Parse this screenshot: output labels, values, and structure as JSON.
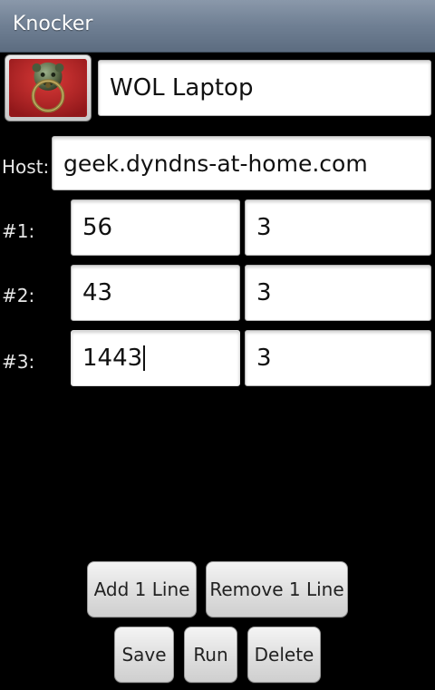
{
  "app": {
    "title": "Knocker"
  },
  "profile": {
    "name_value": "WOL Laptop"
  },
  "host": {
    "label": "Host:",
    "value": "geek.dyndns-at-home.com"
  },
  "lines": [
    {
      "label": "#1:",
      "port": "56",
      "count": "3"
    },
    {
      "label": "#2:",
      "port": "43",
      "count": "3"
    },
    {
      "label": "#3:",
      "port": "1443",
      "count": "3"
    }
  ],
  "buttons": {
    "add_line": "Add 1 Line",
    "remove_line": "Remove 1 Line",
    "save": "Save",
    "run": "Run",
    "delete": "Delete"
  },
  "colors": {
    "titlebar": "#6f7f93",
    "background": "#000000",
    "knocker_red": "#c8262a"
  },
  "icons": {
    "knocker": "door-knocker-icon"
  }
}
